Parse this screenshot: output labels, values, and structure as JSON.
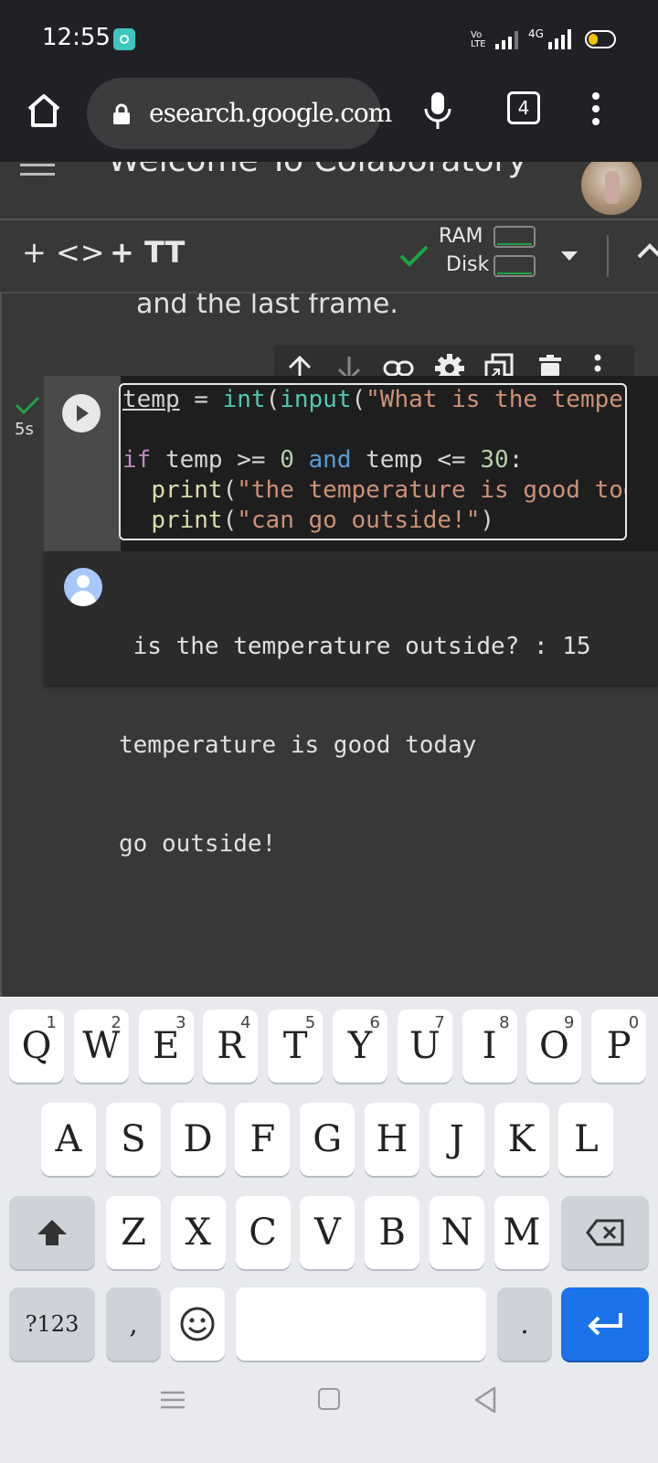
{
  "status": {
    "time": "12:55",
    "volte": "Vo LTE",
    "network": "4G"
  },
  "browser": {
    "url": "esearch.google.com",
    "tab_count": "4"
  },
  "colab": {
    "title": "Welcome To Colaboratory"
  },
  "toolbar": {
    "add_code": "+ <>",
    "add_text": "+ TT",
    "ram_label": "RAM",
    "disk_label": "Disk"
  },
  "notebook": {
    "prev_text": "and the last frame.",
    "exec_time": "5s",
    "code_lines": [
      "temp = int(input(\"What is the temperature outside? : \"))",
      "",
      "if temp >= 0 and temp <= 30:",
      "  print(\"the temperature is good today\")",
      "  print(\"can go outside!\")"
    ],
    "output_lines": [
      " is the temperature outside? : 15",
      "temperature is good today",
      "go outside!"
    ]
  },
  "keyboard": {
    "row1": [
      {
        "k": "Q",
        "h": "1"
      },
      {
        "k": "W",
        "h": "2"
      },
      {
        "k": "E",
        "h": "3"
      },
      {
        "k": "R",
        "h": "4"
      },
      {
        "k": "T",
        "h": "5"
      },
      {
        "k": "Y",
        "h": "6"
      },
      {
        "k": "U",
        "h": "7"
      },
      {
        "k": "I",
        "h": "8"
      },
      {
        "k": "O",
        "h": "9"
      },
      {
        "k": "P",
        "h": "0"
      }
    ],
    "row2": [
      "A",
      "S",
      "D",
      "F",
      "G",
      "H",
      "J",
      "K",
      "L"
    ],
    "row3": [
      "Z",
      "X",
      "C",
      "V",
      "B",
      "N",
      "M"
    ],
    "symbols_label": "?123",
    "comma": ",",
    "period": "."
  }
}
